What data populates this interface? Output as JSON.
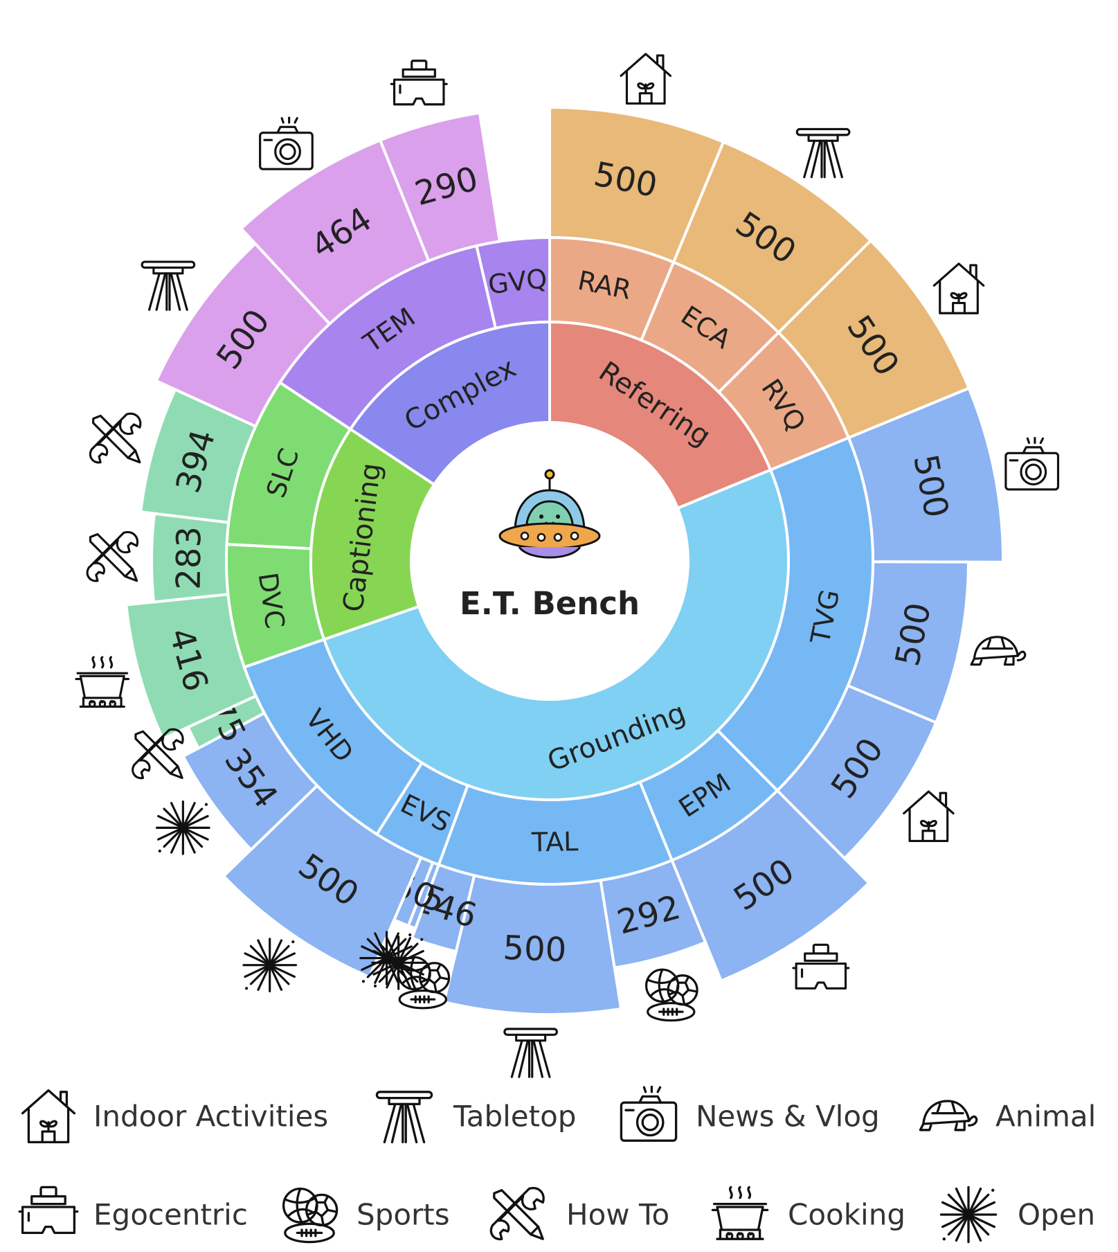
{
  "title": "E.T. Bench",
  "colors": {
    "complex": "#8888ee",
    "complex_mid": "#a784ee",
    "complex_outer": "#daa0ec",
    "referring": "#e5877a",
    "referring_mid": "#eba886",
    "referring_outer": "#e8b978",
    "grounding": "#7fd0f2",
    "grounding_mid": "#76b8f4",
    "grounding_outer": "#8cb3f2",
    "captioning": "#86d653",
    "captioning_mid": "#7fdc73",
    "captioning_outer": "#8fdcb4"
  },
  "inner": [
    {
      "label": "Referring",
      "value": 1500,
      "color": "#e5877a"
    },
    {
      "label": "Grounding",
      "value": 4064,
      "color": "#7fd0f2"
    },
    {
      "label": "Captioning",
      "value": 1168,
      "color": "#86d653"
    },
    {
      "label": "Complex",
      "value": 1254,
      "color": "#8888ee"
    }
  ],
  "middle": [
    {
      "label": "RAR",
      "value": 500,
      "color": "#eba886"
    },
    {
      "label": "ECA",
      "value": 500,
      "color": "#eba886"
    },
    {
      "label": "RVQ",
      "value": 500,
      "color": "#eba886"
    },
    {
      "label": "TVG",
      "value": 1500,
      "color": "#76b8f4"
    },
    {
      "label": "EPM",
      "value": 500,
      "color": "#76b8f4"
    },
    {
      "label": "TAL",
      "value": 938,
      "color": "#76b8f4"
    },
    {
      "label": "EVS",
      "value": 272,
      "color": "#76b8f4"
    },
    {
      "label": "VHD",
      "value": 854,
      "color": "#76b8f4"
    },
    {
      "label": "DVC",
      "value": 491,
      "color": "#7fdc73"
    },
    {
      "label": "SLC",
      "value": 677,
      "color": "#7fdc73"
    },
    {
      "label": "TEM",
      "value": 964,
      "color": "#a784ee"
    },
    {
      "label": "GVQ",
      "value": 290,
      "color": "#a784ee"
    }
  ],
  "outer": [
    {
      "label": "500",
      "value": 500,
      "color": "#e8b978",
      "icon": "indoor",
      "rext": 0
    },
    {
      "label": "500",
      "value": 500,
      "color": "#e8b978",
      "icon": "tabletop",
      "rext": 0
    },
    {
      "label": "500",
      "value": 500,
      "color": "#e8b978",
      "icon": "indoor",
      "rext": 0
    },
    {
      "label": "500",
      "value": 500,
      "color": "#8cb3f2",
      "icon": "camera",
      "rext": 0
    },
    {
      "label": "500",
      "value": 500,
      "color": "#8cb3f2",
      "icon": "animal",
      "rext": -50
    },
    {
      "label": "500",
      "value": 500,
      "color": "#8cb3f2",
      "icon": "indoor",
      "rext": -50
    },
    {
      "label": "500",
      "value": 500,
      "color": "#8cb3f2",
      "icon": "egocentric",
      "rext": 0
    },
    {
      "label": "292",
      "value": 292,
      "color": "#8cb3f2",
      "icon": "sports",
      "rext": -60
    },
    {
      "label": "500",
      "value": 500,
      "color": "#8cb3f2",
      "icon": "tabletop",
      "rext": 0
    },
    {
      "label": "146",
      "value": 146,
      "color": "#8cb3f2",
      "icon": "sports",
      "rext": -75
    },
    {
      "label": "25",
      "value": 25,
      "color": "#8cb3f2",
      "icon": "open",
      "rext": -90
    },
    {
      "label": "50",
      "value": 50,
      "color": "#8cb3f2",
      "icon": "open",
      "rext": -90
    },
    {
      "label": "500",
      "value": 500,
      "color": "#8cb3f2",
      "icon": "open",
      "rext": 0
    },
    {
      "label": "354",
      "value": 354,
      "color": "#8cb3f2",
      "icon": "open",
      "rext": -55
    },
    {
      "label": "75",
      "value": 75,
      "color": "#8fdcb4",
      "icon": "howto",
      "rext": -80
    },
    {
      "label": "416",
      "value": 416,
      "color": "#8fdcb4",
      "icon": "cooking",
      "rext": -40
    },
    {
      "label": "283",
      "value": 283,
      "color": "#8fdcb4",
      "icon": "howto",
      "rext": -80
    },
    {
      "label": "394",
      "value": 394,
      "color": "#8fdcb4",
      "icon": "howto",
      "rext": -60
    },
    {
      "label": "500",
      "value": 500,
      "color": "#daa0ec",
      "icon": "tabletop",
      "rext": -30
    },
    {
      "label": "464",
      "value": 464,
      "color": "#daa0ec",
      "icon": "camera",
      "rext": 0
    },
    {
      "label": "290",
      "value": 290,
      "color": "#daa0ec",
      "icon": "egocentric",
      "rext": 0
    }
  ],
  "legend": [
    {
      "icon": "indoor",
      "label": "Indoor Activities"
    },
    {
      "icon": "tabletop",
      "label": "Tabletop"
    },
    {
      "icon": "camera",
      "label": "News & Vlog"
    },
    {
      "icon": "animal",
      "label": "Animal"
    },
    {
      "icon": "egocentric",
      "label": "Egocentric"
    },
    {
      "icon": "sports",
      "label": "Sports"
    },
    {
      "icon": "howto",
      "label": "How To"
    },
    {
      "icon": "cooking",
      "label": "Cooking"
    },
    {
      "icon": "open",
      "label": "Open"
    }
  ]
}
